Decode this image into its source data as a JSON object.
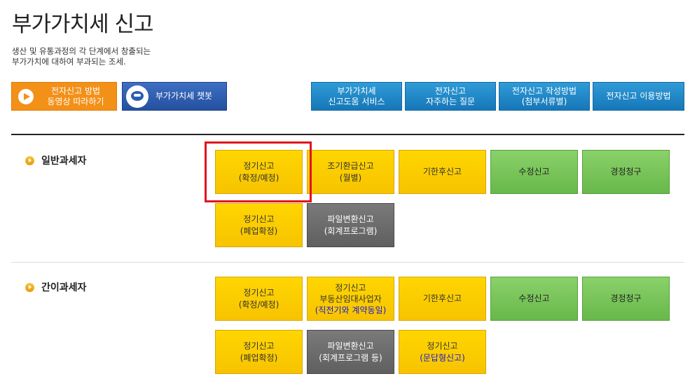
{
  "page": {
    "title": "부가가치세 신고",
    "desc_line1": "생산 및 유통과정의 각 단계에서 창출되는",
    "desc_line2": "부가가치에 대하여 부과되는 조세."
  },
  "top_buttons": {
    "video_line1": "전자신고 방법",
    "video_line2": "동영상 따라하기",
    "chatbot": "부가가치세 챗봇",
    "help_line1": "부가가치세",
    "help_line2": "신고도움 서비스",
    "faq_line1": "전자신고",
    "faq_line2": "자주하는 질문",
    "howto_line1": "전자신고 작성방법",
    "howto_line2": "(첨부서류별)",
    "usage": "전자신고 이용방법"
  },
  "general": {
    "label": "일반과세자",
    "regular_line1": "정기신고",
    "regular_line2": "(확정/예정)",
    "early_line1": "조기환급신고",
    "early_line2": "(월별)",
    "late": "기한후신고",
    "amend": "수정신고",
    "correction": "경정청구",
    "closure_line1": "정기신고",
    "closure_line2": "(폐업확정)",
    "file_line1": "파일변환신고",
    "file_line2": "(회계프로그램)"
  },
  "simple": {
    "label": "간이과세자",
    "regular_line1": "정기신고",
    "regular_line2": "(확정/예정)",
    "realestate_line1": "정기신고",
    "realestate_line2": "부동산임대사업자",
    "realestate_line3": "(직전기와 계약동일)",
    "late": "기한후신고",
    "amend": "수정신고",
    "correction": "경정청구",
    "closure_line1": "정기신고",
    "closure_line2": "(폐업확정)",
    "file_line1": "파일변환신고",
    "file_line2": "(회계프로그램 등)",
    "qa_line1": "정기신고",
    "qa_line2": "(문답형신고)"
  },
  "colors": {
    "accent_orange": "#f39018",
    "chatbot_blue": "#24509e",
    "button_blue": "#1677b8",
    "yellow": "#ffd600",
    "green": "#68b84a",
    "dark_gray": "#5f5f5f",
    "highlight_red": "#e0141e"
  },
  "icons": {
    "play": "play-circle-icon",
    "chatbot": "chatbot-mascot-icon",
    "bullet": "orange-bullet-icon"
  }
}
